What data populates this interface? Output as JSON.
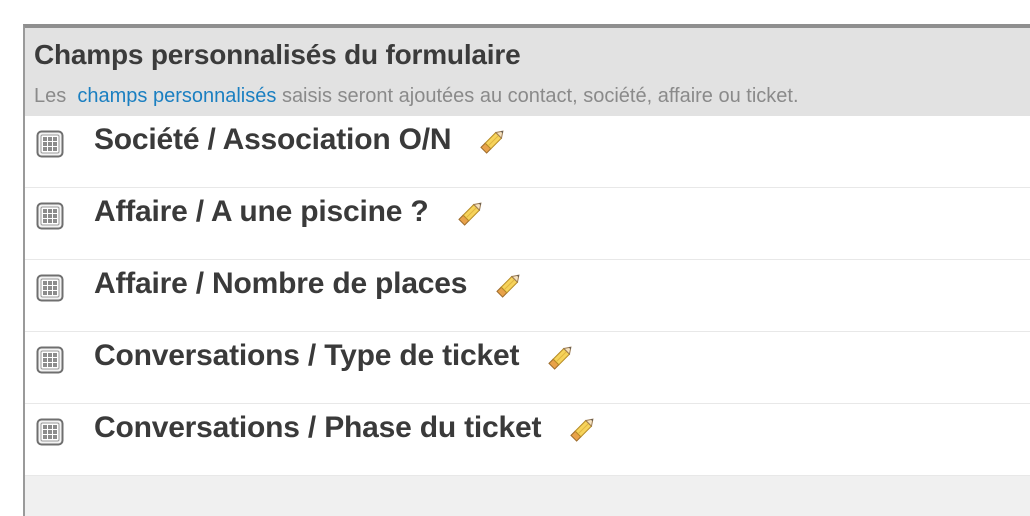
{
  "panel": {
    "title": "Champs personnalisés du formulaire",
    "subtitle_prefix": "Les",
    "subtitle_link": "champs personnalisés",
    "subtitle_suffix": "saisis seront ajoutées au contact, société, affaire ou ticket."
  },
  "fields": [
    {
      "label": "Société / Association O/N",
      "icon": "grid-icon",
      "action_icon": "pencil-icon"
    },
    {
      "label": "Affaire / A une piscine ?",
      "icon": "grid-icon",
      "action_icon": "pencil-icon"
    },
    {
      "label": "Affaire / Nombre de places",
      "icon": "grid-icon",
      "action_icon": "pencil-icon"
    },
    {
      "label": "Conversations / Type de ticket",
      "icon": "grid-icon",
      "action_icon": "pencil-icon"
    },
    {
      "label": "Conversations / Phase du ticket",
      "icon": "grid-icon",
      "action_icon": "pencil-icon"
    }
  ],
  "colors": {
    "header_bg": "#e2e2e2",
    "link": "#1a7fc1",
    "title_text": "#3b3b3b",
    "subtitle_text": "#8a8a8a"
  }
}
